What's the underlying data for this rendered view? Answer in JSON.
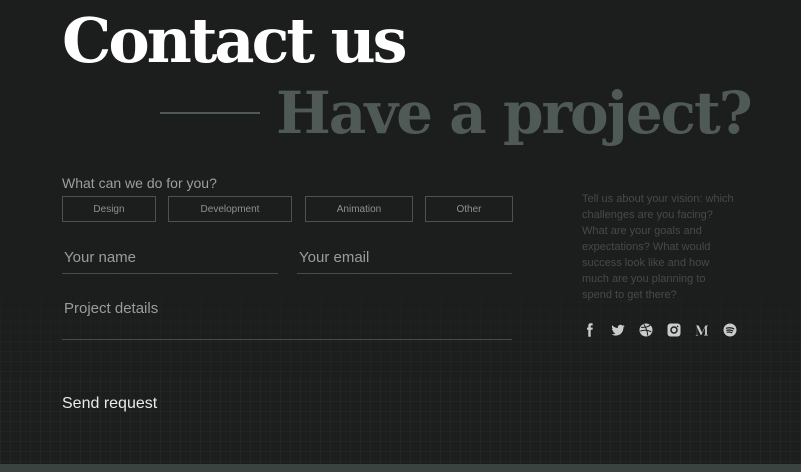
{
  "heading": {
    "title": "Contact us",
    "subtitle": "Have a project?"
  },
  "form": {
    "question": "What can we do for you?",
    "services": [
      {
        "label": "Design"
      },
      {
        "label": "Development"
      },
      {
        "label": "Animation"
      },
      {
        "label": "Other"
      }
    ],
    "name_placeholder": "Your name",
    "email_placeholder": "Your email",
    "details_placeholder": "Project details",
    "send_label": "Send request"
  },
  "sidebar": {
    "prompt_text": "Tell us about your vision: which challenges are you facing? What are your goals and expectations? What would success look like and how much are you planning to spend to get there?"
  },
  "social": [
    {
      "icon": "facebook-icon"
    },
    {
      "icon": "twitter-icon"
    },
    {
      "icon": "dribbble-icon"
    },
    {
      "icon": "instagram-icon"
    },
    {
      "icon": "medium-icon"
    },
    {
      "icon": "spotify-icon"
    }
  ],
  "colors": {
    "background": "#1c1d1d",
    "title": "#ffffff",
    "subtitle": "#4f5955",
    "icon": "#c9ccca"
  }
}
